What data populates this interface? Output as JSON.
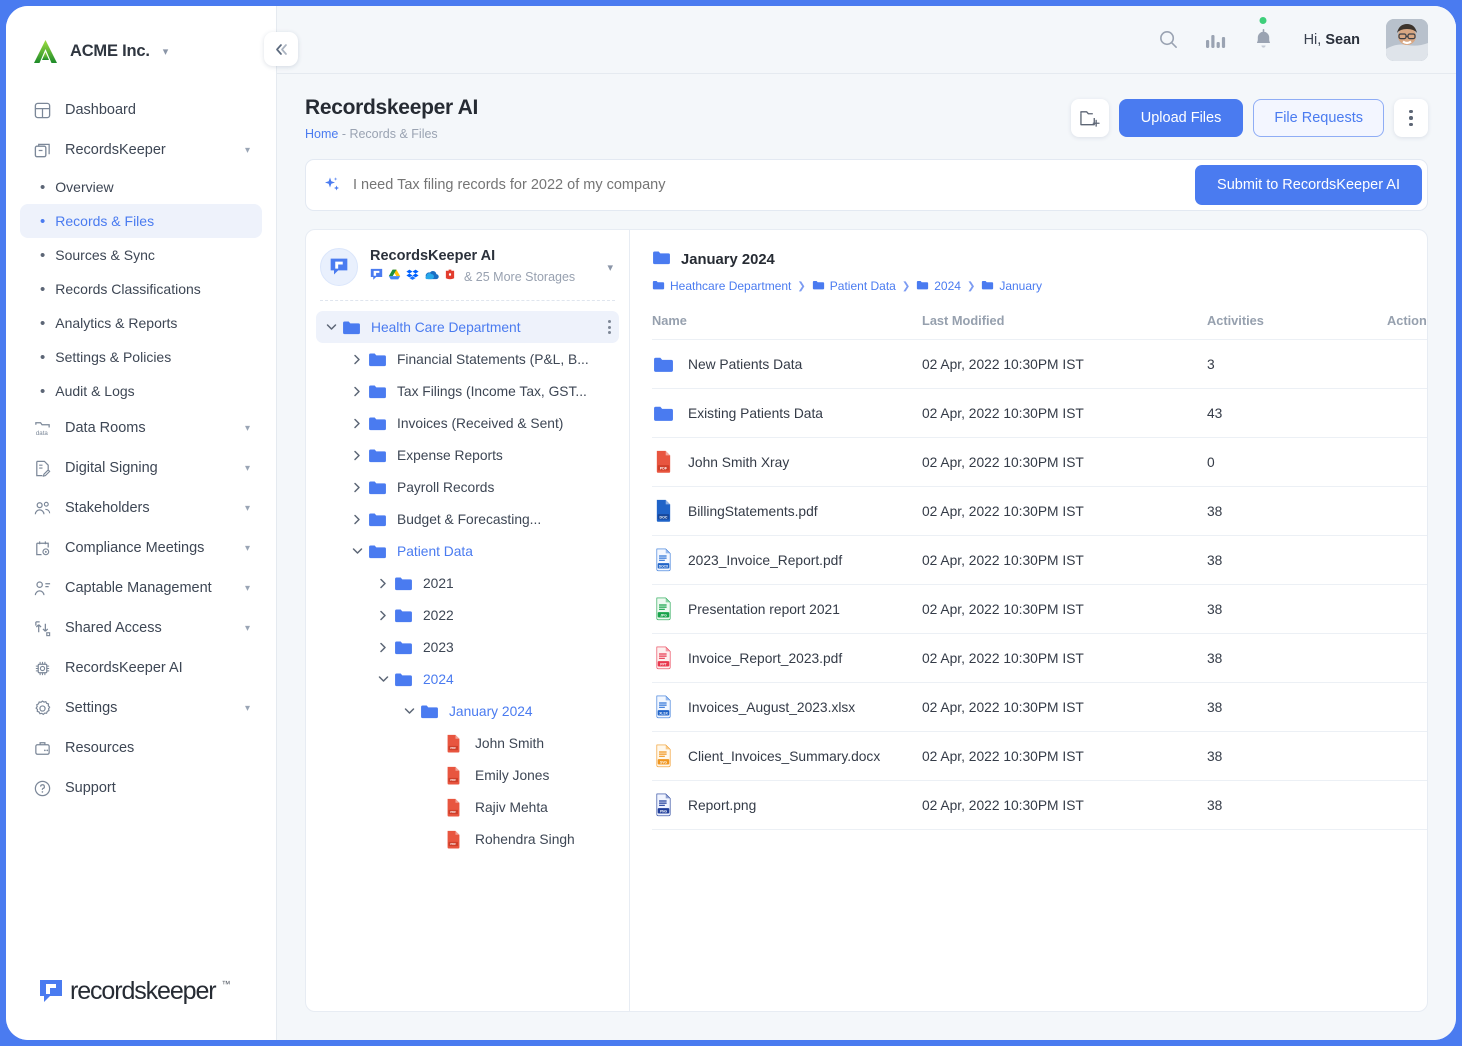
{
  "brand": {
    "name": "ACME Inc.",
    "caret": "chevron-down"
  },
  "collapse_label": "«",
  "sidebar": {
    "items": [
      {
        "label": "Dashboard",
        "icon": "dashboard-icon",
        "chevron": false
      },
      {
        "label": "RecordsKeeper",
        "icon": "records-box-icon",
        "chevron": true
      },
      {
        "label": "Data Rooms",
        "icon": "data-folder-icon",
        "chevron": true
      },
      {
        "label": "Digital Signing",
        "icon": "signature-doc-icon",
        "chevron": true
      },
      {
        "label": "Stakeholders",
        "icon": "people-icon",
        "chevron": true
      },
      {
        "label": "Compliance Meetings",
        "icon": "calendar-gear-icon",
        "chevron": true
      },
      {
        "label": "Captable Management",
        "icon": "person-list-icon",
        "chevron": true
      },
      {
        "label": "Shared Access",
        "icon": "share-arrow-icon",
        "chevron": true
      },
      {
        "label": "RecordsKeeper AI",
        "icon": "chip-icon",
        "chevron": false
      },
      {
        "label": "Settings",
        "icon": "gear-icon",
        "chevron": true
      },
      {
        "label": "Resources",
        "icon": "briefcase-icon",
        "chevron": false
      },
      {
        "label": "Support",
        "icon": "help-circle-icon",
        "chevron": false
      }
    ],
    "sub_items": [
      {
        "label": "Overview",
        "active": false
      },
      {
        "label": "Records & Files",
        "active": true
      },
      {
        "label": "Sources & Sync",
        "active": false
      },
      {
        "label": "Records Classifications",
        "active": false
      },
      {
        "label": "Analytics & Reports",
        "active": false
      },
      {
        "label": "Settings & Policies",
        "active": false
      },
      {
        "label": "Audit & Logs",
        "active": false
      }
    ],
    "footer_logo": {
      "word": "recordskeeper",
      "tm": "™"
    }
  },
  "topbar": {
    "search_icon": "search-icon",
    "analytics_icon": "bar-chart-icon",
    "bell_icon": "bell-icon",
    "has_notification": true,
    "greeting_prefix": "Hi, ",
    "user_name": "Sean",
    "avatar": "user-avatar"
  },
  "page": {
    "title": "Recordskeeper AI",
    "breadcrumb_home": "Home",
    "breadcrumb_sep": " - ",
    "breadcrumb_current": "Records & Files",
    "new_folder_icon": "new-folder-icon",
    "upload_label": "Upload Files",
    "file_requests_label": "File Requests",
    "more_icon": "kebab-menu-icon"
  },
  "ai_bar": {
    "sparkle_icon": "sparkle-icon",
    "placeholder": "I need Tax filing records for 2022 of my company",
    "value": "",
    "submit_label": "Submit to RecordsKeeper AI"
  },
  "storage": {
    "title": "RecordsKeeper AI",
    "logo_icon": "recordskeeper-mark-icon",
    "connected": [
      "recordskeeper-icon",
      "google-drive-icon",
      "dropbox-icon",
      "onedrive-icon",
      "box-icon"
    ],
    "more_text": "& 25 More Storages",
    "caret": "chevron-down-icon"
  },
  "tree": [
    {
      "label": "Health Care Department",
      "indent": 0,
      "state": "expanded",
      "type": "folder",
      "highlight": true,
      "kebab": true
    },
    {
      "label": "Financial Statements (P&L, B...",
      "indent": 1,
      "state": "collapsed",
      "type": "folder"
    },
    {
      "label": "Tax Filings (Income Tax, GST...",
      "indent": 1,
      "state": "collapsed",
      "type": "folder"
    },
    {
      "label": "Invoices (Received & Sent)",
      "indent": 1,
      "state": "collapsed",
      "type": "folder"
    },
    {
      "label": "Expense Reports",
      "indent": 1,
      "state": "collapsed",
      "type": "folder"
    },
    {
      "label": "Payroll Records",
      "indent": 1,
      "state": "collapsed",
      "type": "folder"
    },
    {
      "label": "Budget & Forecasting...",
      "indent": 1,
      "state": "collapsed",
      "type": "folder"
    },
    {
      "label": "Patient Data",
      "indent": 1,
      "state": "expanded",
      "type": "folder",
      "selected": true
    },
    {
      "label": "2021",
      "indent": 2,
      "state": "collapsed",
      "type": "folder"
    },
    {
      "label": "2022",
      "indent": 2,
      "state": "collapsed",
      "type": "folder"
    },
    {
      "label": "2023",
      "indent": 2,
      "state": "collapsed",
      "type": "folder"
    },
    {
      "label": "2024",
      "indent": 2,
      "state": "expanded",
      "type": "folder",
      "selected": true
    },
    {
      "label": "January 2024",
      "indent": 3,
      "state": "expanded",
      "type": "folder",
      "selected": true
    },
    {
      "label": "John Smith",
      "indent": 4,
      "state": "none",
      "type": "pdf"
    },
    {
      "label": "Emily Jones",
      "indent": 4,
      "state": "none",
      "type": "pdf"
    },
    {
      "label": "Rajiv Mehta",
      "indent": 4,
      "state": "none",
      "type": "pdf"
    },
    {
      "label": "Rohendra Singh",
      "indent": 4,
      "state": "none",
      "type": "pdf"
    }
  ],
  "list": {
    "folder_name": "January 2024",
    "folder_icon": "folder-icon",
    "breadcrumbs": [
      "Heathcare Department",
      "Patient Data",
      "2024",
      "January"
    ],
    "columns": [
      "Name",
      "Last Modified",
      "Activities",
      "Actions"
    ],
    "rows": [
      {
        "name": "New Patients Data",
        "icon": "folder-icon",
        "modified": "02 Apr, 2022 10:30PM IST",
        "activities": "3",
        "kebab_style": "gray"
      },
      {
        "name": "Existing Patients Data",
        "icon": "folder-icon",
        "modified": "02 Apr, 2022 10:30PM IST",
        "activities": "43",
        "kebab_style": "gray"
      },
      {
        "name": "John Smith Xray",
        "icon": "pdf-file-icon",
        "modified": "02 Apr, 2022 10:30PM IST",
        "activities": "0",
        "kebab_style": "gray"
      },
      {
        "name": "BillingStatements.pdf",
        "icon": "doc-file-icon",
        "modified": "02 Apr, 2022 10:30PM IST",
        "activities": "38",
        "kebab_style": "blue"
      },
      {
        "name": "2023_Invoice_Report.pdf",
        "icon": "docx-file-icon",
        "modified": "02 Apr, 2022 10:30PM IST",
        "activities": "38",
        "kebab_style": "blue"
      },
      {
        "name": "Presentation report 2021",
        "icon": "jpg-file-icon",
        "modified": "02 Apr, 2022 10:30PM IST",
        "activities": "38",
        "kebab_style": "blue"
      },
      {
        "name": "Invoice_Report_2023.pdf",
        "icon": "ppt-file-icon",
        "modified": "02 Apr, 2022 10:30PM IST",
        "activities": "38",
        "kebab_style": "blue"
      },
      {
        "name": "Invoices_August_2023.xlsx",
        "icon": "xlsx-file-icon",
        "modified": "02 Apr, 2022 10:30PM IST",
        "activities": "38",
        "kebab_style": "blue"
      },
      {
        "name": "Client_Invoices_Summary.docx",
        "icon": "svg-file-icon",
        "modified": "02 Apr, 2022 10:30PM IST",
        "activities": "38",
        "kebab_style": "blue"
      },
      {
        "name": "Report.png",
        "icon": "png-file-icon",
        "modified": "02 Apr, 2022 10:30PM IST",
        "activities": "38",
        "kebab_style": "blue"
      }
    ]
  },
  "colors": {
    "accent": "#4a7bf0",
    "page_bg": "#f4f7fa",
    "folder_blue": "#4a7bf0",
    "pdf_red": "#e8553f",
    "text_dark": "#262b33",
    "text_muted": "#96a0ae",
    "online_green": "#3ecf7a"
  }
}
